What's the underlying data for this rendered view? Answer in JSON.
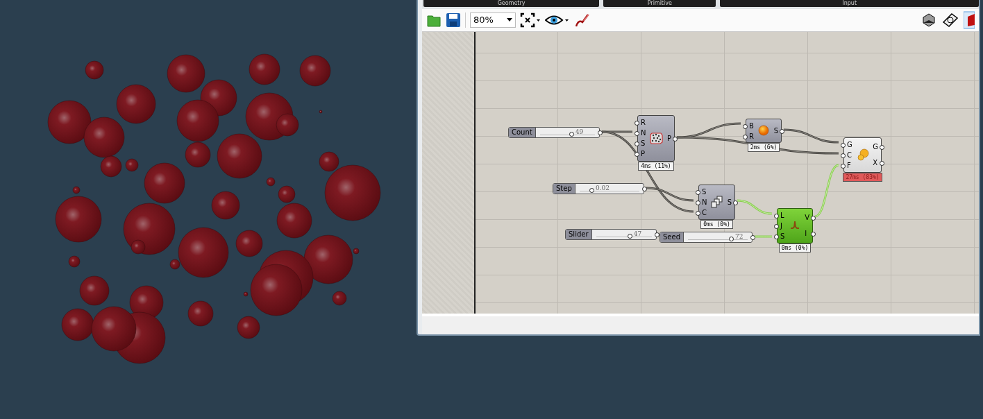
{
  "tabs": [
    {
      "label": "Geometry"
    },
    {
      "label": "Primitive"
    },
    {
      "label": "Input"
    }
  ],
  "toolbar": {
    "zoom": "80%"
  },
  "sliders": [
    {
      "label": "Count",
      "value": "49",
      "level": 0.57
    },
    {
      "label": "Step",
      "value": "0.02",
      "level": 0.2
    },
    {
      "label": "Slider",
      "value": "47",
      "level": 0.6
    },
    {
      "label": "Seed",
      "value": "72",
      "level": 0.72
    }
  ],
  "components": [
    {
      "kind": "populate",
      "inputs": [
        "R",
        "N",
        "S",
        "P"
      ],
      "outputs": [
        "P"
      ],
      "timing": "4ms (11%)",
      "selected": false,
      "preview": true,
      "profiler_hot": false
    },
    {
      "kind": "sphere",
      "inputs": [
        "B",
        "R"
      ],
      "outputs": [
        "S"
      ],
      "timing": "2ms (6%)",
      "selected": false,
      "preview": true,
      "profiler_hot": false
    },
    {
      "kind": "series",
      "inputs": [
        "S",
        "N",
        "C"
      ],
      "outputs": [
        "S"
      ],
      "timing": "0ms (0%)",
      "selected": false,
      "preview": true,
      "profiler_hot": false
    },
    {
      "kind": "graph",
      "inputs": [
        "L",
        "J",
        "S"
      ],
      "outputs": [
        "V",
        "I"
      ],
      "timing": "0ms (0%)",
      "selected": true,
      "preview": true,
      "profiler_hot": false
    },
    {
      "kind": "pack",
      "inputs": [
        "G",
        "C",
        "F"
      ],
      "outputs": [
        "G",
        "X"
      ],
      "timing": "27ms (83%)",
      "selected": false,
      "preview": false,
      "profiler_hot": true
    }
  ]
}
